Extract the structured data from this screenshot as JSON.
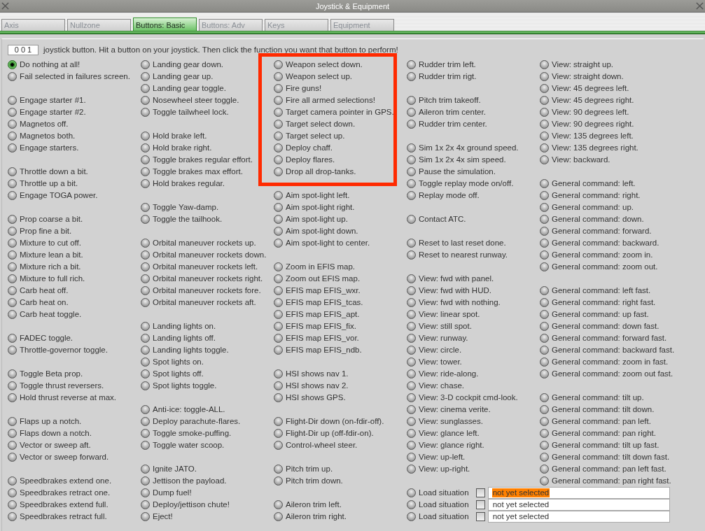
{
  "window": {
    "title": "Joystick & Equipment"
  },
  "tabs": [
    {
      "label": "Axis",
      "selected": false
    },
    {
      "label": "Nullzone",
      "selected": false
    },
    {
      "label": "Buttons: Basic",
      "selected": true
    },
    {
      "label": "Buttons: Adv",
      "selected": false
    },
    {
      "label": "Keys",
      "selected": false
    },
    {
      "label": "Equipment",
      "selected": false
    }
  ],
  "button_number": "0 0 1",
  "instruction": "joystick button. Hit a button on your joystick. Then click the function you want that button to perform!",
  "columns": [
    [
      {
        "kind": "option",
        "label": "Do nothing at all!",
        "selected": true
      },
      {
        "kind": "option",
        "label": "Fail selected in failures screen.",
        "selected": false
      },
      {
        "kind": "gap"
      },
      {
        "kind": "option",
        "label": "Engage starter #1.",
        "selected": false
      },
      {
        "kind": "option",
        "label": "Engage starter #2.",
        "selected": false
      },
      {
        "kind": "option",
        "label": "Magnetos off.",
        "selected": false
      },
      {
        "kind": "option",
        "label": "Magnetos both.",
        "selected": false
      },
      {
        "kind": "option",
        "label": "Engage starters.",
        "selected": false
      },
      {
        "kind": "gap"
      },
      {
        "kind": "option",
        "label": "Throttle down a bit.",
        "selected": false
      },
      {
        "kind": "option",
        "label": "Throttle up a bit.",
        "selected": false
      },
      {
        "kind": "option",
        "label": "Engage TOGA power.",
        "selected": false
      },
      {
        "kind": "gap"
      },
      {
        "kind": "option",
        "label": "Prop coarse a bit.",
        "selected": false
      },
      {
        "kind": "option",
        "label": "Prop fine a bit.",
        "selected": false
      },
      {
        "kind": "option",
        "label": "Mixture to cut off.",
        "selected": false
      },
      {
        "kind": "option",
        "label": "Mixture lean a bit.",
        "selected": false
      },
      {
        "kind": "option",
        "label": "Mixture rich a bit.",
        "selected": false
      },
      {
        "kind": "option",
        "label": "Mixture to full rich.",
        "selected": false
      },
      {
        "kind": "option",
        "label": "Carb heat off.",
        "selected": false
      },
      {
        "kind": "option",
        "label": "Carb heat on.",
        "selected": false
      },
      {
        "kind": "option",
        "label": "Carb heat toggle.",
        "selected": false
      },
      {
        "kind": "gap"
      },
      {
        "kind": "option",
        "label": "FADEC toggle.",
        "selected": false
      },
      {
        "kind": "option",
        "label": "Throttle-governor toggle.",
        "selected": false
      },
      {
        "kind": "gap"
      },
      {
        "kind": "option",
        "label": "Toggle Beta prop.",
        "selected": false
      },
      {
        "kind": "option",
        "label": "Toggle thrust reversers.",
        "selected": false
      },
      {
        "kind": "option",
        "label": "Hold thrust reverse at max.",
        "selected": false
      },
      {
        "kind": "gap"
      },
      {
        "kind": "option",
        "label": "Flaps up a notch.",
        "selected": false
      },
      {
        "kind": "option",
        "label": "Flaps down a notch.",
        "selected": false
      },
      {
        "kind": "option",
        "label": "Vector or sweep aft.",
        "selected": false
      },
      {
        "kind": "option",
        "label": "Vector or sweep forward.",
        "selected": false
      },
      {
        "kind": "gap"
      },
      {
        "kind": "option",
        "label": "Speedbrakes extend one.",
        "selected": false
      },
      {
        "kind": "option",
        "label": "Speedbrakes retract one.",
        "selected": false
      },
      {
        "kind": "option",
        "label": "Speedbrakes extend full.",
        "selected": false
      },
      {
        "kind": "option",
        "label": "Speedbrakes retract full.",
        "selected": false
      }
    ],
    [
      {
        "kind": "option",
        "label": "Landing gear down.",
        "selected": false
      },
      {
        "kind": "option",
        "label": "Landing gear up.",
        "selected": false
      },
      {
        "kind": "option",
        "label": "Landing gear toggle.",
        "selected": false
      },
      {
        "kind": "option",
        "label": "Nosewheel steer toggle.",
        "selected": false
      },
      {
        "kind": "option",
        "label": "Toggle tailwheel lock.",
        "selected": false
      },
      {
        "kind": "gap"
      },
      {
        "kind": "option",
        "label": "Hold brake left.",
        "selected": false
      },
      {
        "kind": "option",
        "label": "Hold brake right.",
        "selected": false
      },
      {
        "kind": "option",
        "label": "Toggle brakes regular effort.",
        "selected": false
      },
      {
        "kind": "option",
        "label": "Toggle brakes max effort.",
        "selected": false
      },
      {
        "kind": "option",
        "label": "Hold brakes regular.",
        "selected": false
      },
      {
        "kind": "gap"
      },
      {
        "kind": "option",
        "label": "Toggle Yaw-damp.",
        "selected": false
      },
      {
        "kind": "option",
        "label": "Toggle the tailhook.",
        "selected": false
      },
      {
        "kind": "gap"
      },
      {
        "kind": "option",
        "label": "Orbital maneuver rockets up.",
        "selected": false
      },
      {
        "kind": "option",
        "label": "Orbital maneuver rockets down.",
        "selected": false
      },
      {
        "kind": "option",
        "label": "Orbital maneuver rockets left.",
        "selected": false
      },
      {
        "kind": "option",
        "label": "Orbital maneuver rockets right.",
        "selected": false
      },
      {
        "kind": "option",
        "label": "Orbital maneuver rockets fore.",
        "selected": false
      },
      {
        "kind": "option",
        "label": "Orbital maneuver rockets aft.",
        "selected": false
      },
      {
        "kind": "gap"
      },
      {
        "kind": "option",
        "label": "Landing lights on.",
        "selected": false
      },
      {
        "kind": "option",
        "label": "Landing lights off.",
        "selected": false
      },
      {
        "kind": "option",
        "label": "Landing lights toggle.",
        "selected": false
      },
      {
        "kind": "option",
        "label": "Spot lights on.",
        "selected": false
      },
      {
        "kind": "option",
        "label": "Spot lights off.",
        "selected": false
      },
      {
        "kind": "option",
        "label": "Spot lights toggle.",
        "selected": false
      },
      {
        "kind": "gap"
      },
      {
        "kind": "option",
        "label": "Anti-ice: toggle-ALL.",
        "selected": false
      },
      {
        "kind": "option",
        "label": "Deploy parachute-flares.",
        "selected": false
      },
      {
        "kind": "option",
        "label": "Toggle smoke-puffing.",
        "selected": false
      },
      {
        "kind": "option",
        "label": "Toggle water scoop.",
        "selected": false
      },
      {
        "kind": "gap"
      },
      {
        "kind": "option",
        "label": "Ignite JATO.",
        "selected": false
      },
      {
        "kind": "option",
        "label": "Jettison the payload.",
        "selected": false
      },
      {
        "kind": "option",
        "label": "Dump fuel!",
        "selected": false
      },
      {
        "kind": "option",
        "label": "Deploy/jettison chute!",
        "selected": false
      },
      {
        "kind": "option",
        "label": "Eject!",
        "selected": false
      }
    ],
    [
      {
        "kind": "option",
        "label": "Weapon select down.",
        "selected": false
      },
      {
        "kind": "option",
        "label": "Weapon select up.",
        "selected": false
      },
      {
        "kind": "option",
        "label": "Fire guns!",
        "selected": false
      },
      {
        "kind": "option",
        "label": "Fire all armed selections!",
        "selected": false
      },
      {
        "kind": "option",
        "label": "Target camera pointer in GPS.",
        "selected": false
      },
      {
        "kind": "option",
        "label": "Target select down.",
        "selected": false
      },
      {
        "kind": "option",
        "label": "Target select up.",
        "selected": false
      },
      {
        "kind": "option",
        "label": "Deploy chaff.",
        "selected": false
      },
      {
        "kind": "option",
        "label": "Deploy flares.",
        "selected": false
      },
      {
        "kind": "option",
        "label": "Drop all drop-tanks.",
        "selected": false
      },
      {
        "kind": "gap"
      },
      {
        "kind": "option",
        "label": "Aim spot-light left.",
        "selected": false
      },
      {
        "kind": "option",
        "label": "Aim spot-light right.",
        "selected": false
      },
      {
        "kind": "option",
        "label": "Aim spot-light up.",
        "selected": false
      },
      {
        "kind": "option",
        "label": "Aim spot-light down.",
        "selected": false
      },
      {
        "kind": "option",
        "label": "Aim spot-light to center.",
        "selected": false
      },
      {
        "kind": "gap"
      },
      {
        "kind": "option",
        "label": "Zoom in EFIS map.",
        "selected": false
      },
      {
        "kind": "option",
        "label": "Zoom out EFIS map.",
        "selected": false
      },
      {
        "kind": "option",
        "label": "EFIS map EFIS_wxr.",
        "selected": false
      },
      {
        "kind": "option",
        "label": "EFIS map EFIS_tcas.",
        "selected": false
      },
      {
        "kind": "option",
        "label": "EFIS map EFIS_apt.",
        "selected": false
      },
      {
        "kind": "option",
        "label": "EFIS map EFIS_fix.",
        "selected": false
      },
      {
        "kind": "option",
        "label": "EFIS map EFIS_vor.",
        "selected": false
      },
      {
        "kind": "option",
        "label": "EFIS map EFIS_ndb.",
        "selected": false
      },
      {
        "kind": "gap"
      },
      {
        "kind": "option",
        "label": "HSI shows nav 1.",
        "selected": false
      },
      {
        "kind": "option",
        "label": "HSI shows nav 2.",
        "selected": false
      },
      {
        "kind": "option",
        "label": "HSI shows GPS.",
        "selected": false
      },
      {
        "kind": "gap"
      },
      {
        "kind": "option",
        "label": "Flight-Dir down (on-fdir-off).",
        "selected": false
      },
      {
        "kind": "option",
        "label": "Flight-Dir up (off-fdir-on).",
        "selected": false
      },
      {
        "kind": "option",
        "label": "Control-wheel steer.",
        "selected": false
      },
      {
        "kind": "gap"
      },
      {
        "kind": "option",
        "label": "Pitch trim up.",
        "selected": false
      },
      {
        "kind": "option",
        "label": "Pitch trim down.",
        "selected": false
      },
      {
        "kind": "gap"
      },
      {
        "kind": "option",
        "label": "Aileron trim left.",
        "selected": false
      },
      {
        "kind": "option",
        "label": "Aileron trim right.",
        "selected": false
      }
    ],
    [
      {
        "kind": "option",
        "label": "Rudder trim left.",
        "selected": false
      },
      {
        "kind": "option",
        "label": "Rudder trim rigt.",
        "selected": false
      },
      {
        "kind": "gap"
      },
      {
        "kind": "option",
        "label": "Pitch trim takeoff.",
        "selected": false
      },
      {
        "kind": "option",
        "label": "Aileron trim center.",
        "selected": false
      },
      {
        "kind": "option",
        "label": "Rudder trim center.",
        "selected": false
      },
      {
        "kind": "gap"
      },
      {
        "kind": "option",
        "label": "Sim 1x 2x 4x ground speed.",
        "selected": false
      },
      {
        "kind": "option",
        "label": "Sim 1x 2x 4x sim speed.",
        "selected": false
      },
      {
        "kind": "option",
        "label": "Pause the simulation.",
        "selected": false
      },
      {
        "kind": "option",
        "label": "Toggle replay mode on/off.",
        "selected": false
      },
      {
        "kind": "option",
        "label": "Replay mode off.",
        "selected": false
      },
      {
        "kind": "gap"
      },
      {
        "kind": "option",
        "label": "Contact ATC.",
        "selected": false
      },
      {
        "kind": "gap"
      },
      {
        "kind": "option",
        "label": "Reset to last reset done.",
        "selected": false
      },
      {
        "kind": "option",
        "label": "Reset to nearest runway.",
        "selected": false
      },
      {
        "kind": "gap"
      },
      {
        "kind": "option",
        "label": "View: fwd with panel.",
        "selected": false
      },
      {
        "kind": "option",
        "label": "View: fwd with HUD.",
        "selected": false
      },
      {
        "kind": "option",
        "label": "View: fwd with nothing.",
        "selected": false
      },
      {
        "kind": "option",
        "label": "View: linear spot.",
        "selected": false
      },
      {
        "kind": "option",
        "label": "View: still spot.",
        "selected": false
      },
      {
        "kind": "option",
        "label": "View: runway.",
        "selected": false
      },
      {
        "kind": "option",
        "label": "View: circle.",
        "selected": false
      },
      {
        "kind": "option",
        "label": "View: tower.",
        "selected": false
      },
      {
        "kind": "option",
        "label": "View: ride-along.",
        "selected": false
      },
      {
        "kind": "option",
        "label": "View: chase.",
        "selected": false
      },
      {
        "kind": "option",
        "label": "View: 3-D cockpit cmd-look.",
        "selected": false
      },
      {
        "kind": "option",
        "label": "View: cinema verite.",
        "selected": false
      },
      {
        "kind": "option",
        "label": "View: sunglasses.",
        "selected": false
      },
      {
        "kind": "option",
        "label": "View: glance left.",
        "selected": false
      },
      {
        "kind": "option",
        "label": "View: glance right.",
        "selected": false
      },
      {
        "kind": "option",
        "label": "View: up-left.",
        "selected": false
      },
      {
        "kind": "option",
        "label": "View: up-right.",
        "selected": false
      }
    ],
    [
      {
        "kind": "option",
        "label": "View: straight up.",
        "selected": false
      },
      {
        "kind": "option",
        "label": "View: straight down.",
        "selected": false
      },
      {
        "kind": "option",
        "label": "View: 45 degrees left.",
        "selected": false
      },
      {
        "kind": "option",
        "label": "View: 45 degrees right.",
        "selected": false
      },
      {
        "kind": "option",
        "label": "View: 90 degrees left.",
        "selected": false
      },
      {
        "kind": "option",
        "label": "View: 90 degrees right.",
        "selected": false
      },
      {
        "kind": "option",
        "label": "View: 135 degrees left.",
        "selected": false
      },
      {
        "kind": "option",
        "label": "View: 135 degrees right.",
        "selected": false
      },
      {
        "kind": "option",
        "label": "View: backward.",
        "selected": false
      },
      {
        "kind": "gap"
      },
      {
        "kind": "option",
        "label": "General command: left.",
        "selected": false
      },
      {
        "kind": "option",
        "label": "General command: right.",
        "selected": false
      },
      {
        "kind": "option",
        "label": "General command: up.",
        "selected": false
      },
      {
        "kind": "option",
        "label": "General command: down.",
        "selected": false
      },
      {
        "kind": "option",
        "label": "General command: forward.",
        "selected": false
      },
      {
        "kind": "option",
        "label": "General command: backward.",
        "selected": false
      },
      {
        "kind": "option",
        "label": "General command: zoom in.",
        "selected": false
      },
      {
        "kind": "option",
        "label": "General command: zoom out.",
        "selected": false
      },
      {
        "kind": "gap"
      },
      {
        "kind": "option",
        "label": "General command: left fast.",
        "selected": false
      },
      {
        "kind": "option",
        "label": "General command: right fast.",
        "selected": false
      },
      {
        "kind": "option",
        "label": "General command: up fast.",
        "selected": false
      },
      {
        "kind": "option",
        "label": "General command: down fast.",
        "selected": false
      },
      {
        "kind": "option",
        "label": "General command: forward fast.",
        "selected": false
      },
      {
        "kind": "option",
        "label": "General command: backward fast.",
        "selected": false
      },
      {
        "kind": "option",
        "label": "General command: zoom in fast.",
        "selected": false
      },
      {
        "kind": "option",
        "label": "General command: zoom out fast.",
        "selected": false
      },
      {
        "kind": "gap"
      },
      {
        "kind": "option",
        "label": "General command: tilt up.",
        "selected": false
      },
      {
        "kind": "option",
        "label": "General command: tilt down.",
        "selected": false
      },
      {
        "kind": "option",
        "label": "General command: pan left.",
        "selected": false
      },
      {
        "kind": "option",
        "label": "General command: pan right.",
        "selected": false
      },
      {
        "kind": "option",
        "label": "General command: tilt up fast.",
        "selected": false
      },
      {
        "kind": "option",
        "label": "General command: tilt down fast.",
        "selected": false
      },
      {
        "kind": "option",
        "label": "General command: pan left fast.",
        "selected": false
      },
      {
        "kind": "option",
        "label": "General command: pan right fast.",
        "selected": false
      }
    ]
  ],
  "load_slots": [
    {
      "label": "Load situation",
      "selected": false,
      "checked": false,
      "value": "not yet selected",
      "highlighted": true
    },
    {
      "label": "Load situation",
      "selected": false,
      "checked": false,
      "value": "not yet selected",
      "highlighted": false
    },
    {
      "label": "Load situation",
      "selected": false,
      "checked": false,
      "value": "not yet selected",
      "highlighted": false
    }
  ]
}
